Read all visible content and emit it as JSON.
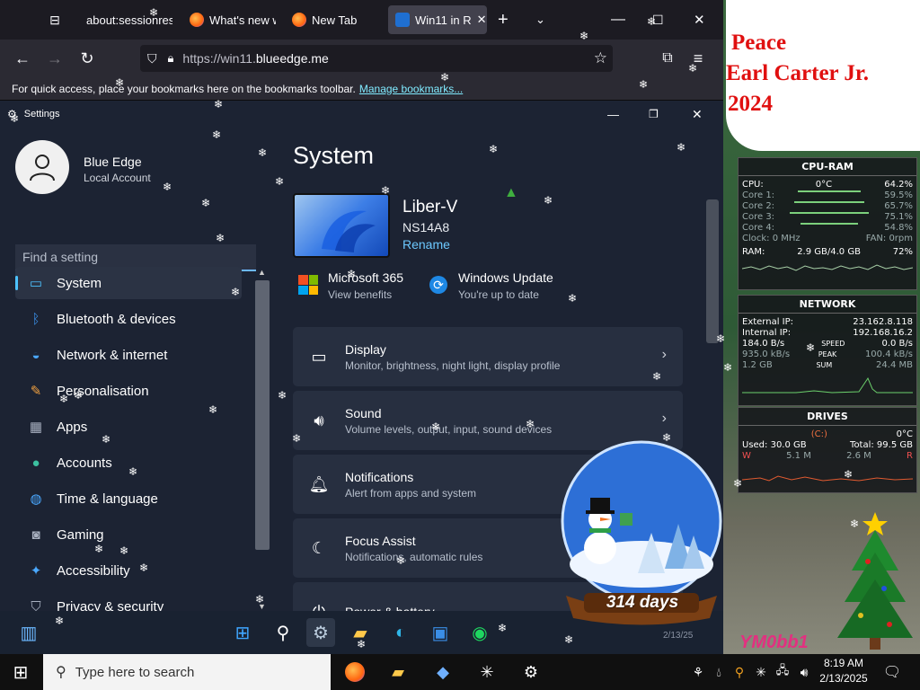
{
  "browser": {
    "tabs": [
      {
        "label": "about:sessionrest",
        "icon": "restore-icon"
      },
      {
        "label": "What's new w",
        "icon": "firefox-icon"
      },
      {
        "label": "New Tab",
        "icon": "firefox-icon"
      },
      {
        "label": "Win11 in R",
        "icon": "win11-favicon"
      }
    ],
    "url_prefix": "https://win11.",
    "url_domain": "blueedge.me",
    "bookmarks_text": "For quick access, place your bookmarks here on the bookmarks toolbar.",
    "bookmarks_link": "Manage bookmarks..."
  },
  "settings": {
    "window_title": "Settings",
    "user_name": "Blue Edge",
    "account_type": "Local Account",
    "search_placeholder": "Find a setting",
    "nav": [
      {
        "label": "System",
        "icon": "system-icon",
        "selected": true
      },
      {
        "label": "Bluetooth & devices",
        "icon": "bluetooth-icon"
      },
      {
        "label": "Network & internet",
        "icon": "wifi-icon"
      },
      {
        "label": "Personalisation",
        "icon": "brush-icon"
      },
      {
        "label": "Apps",
        "icon": "apps-icon"
      },
      {
        "label": "Accounts",
        "icon": "account-icon"
      },
      {
        "label": "Time & language",
        "icon": "globe-icon"
      },
      {
        "label": "Gaming",
        "icon": "gamepad-icon"
      },
      {
        "label": "Accessibility",
        "icon": "accessibility-icon"
      },
      {
        "label": "Privacy & security",
        "icon": "shield-icon"
      }
    ],
    "page_title": "System",
    "device_name": "Liber-V",
    "device_model": "NS14A8",
    "rename_label": "Rename",
    "ms365_title": "Microsoft 365",
    "ms365_sub": "View benefits",
    "wu_title": "Windows Update",
    "wu_sub": "You're up to date",
    "cards": [
      {
        "title": "Display",
        "sub": "Monitor, brightness, night light, display profile",
        "icon": "display-icon"
      },
      {
        "title": "Sound",
        "sub": "Volume levels, output, input, sound devices",
        "icon": "speaker-icon"
      },
      {
        "title": "Notifications",
        "sub": "Alert from apps and system",
        "icon": "bell-icon"
      },
      {
        "title": "Focus Assist",
        "sub": "Notifications, automatic rules",
        "icon": "moon-icon"
      },
      {
        "title": "Power & battery",
        "sub": "",
        "icon": "power-icon"
      }
    ],
    "win_tray_date": "2/13/25"
  },
  "greeting": {
    "line1": "Peace",
    "line2": "Earl Carter Jr.",
    "line3": "2024"
  },
  "cpu_gadget": {
    "title": "CPU-RAM",
    "cpu_label": "CPU:",
    "cpu_temp": "0°C",
    "cpu_pct": "64.2%",
    "cores": [
      {
        "label": "Core 1:",
        "value": "59.5%",
        "fill": 0.595
      },
      {
        "label": "Core 2:",
        "value": "65.7%",
        "fill": 0.657
      },
      {
        "label": "Core 3:",
        "value": "75.1%",
        "fill": 0.751
      },
      {
        "label": "Core 4:",
        "value": "54.8%",
        "fill": 0.548
      }
    ],
    "clock": "Clock: 0 MHz",
    "fan": "FAN: 0rpm",
    "ram_label": "RAM:",
    "ram_usage": "2.9 GB/4.0 GB",
    "ram_pct": "72%"
  },
  "net_gadget": {
    "title": "NETWORK",
    "ext_label": "External IP:",
    "ext_ip": "23.162.8.118",
    "int_label": "Internal IP:",
    "int_ip": "192.168.16.2",
    "speed_down": "184.0 B/s",
    "speed_label": "SPEED",
    "speed_up": "0.0 B/s",
    "peak_down": "935.0 kB/s",
    "peak_label": "PEAK",
    "peak_up": "100.4 kB/s",
    "sum_down": "1.2 GB",
    "sum_label": "SUM",
    "sum_up": "24.4 MB"
  },
  "drives_gadget": {
    "title": "DRIVES",
    "drive": "(C:)",
    "temp": "0°C",
    "used": "Used: 30.0 GB",
    "total": "Total: 99.5 GB",
    "read_label": "W",
    "read": "5.1 M",
    "write": "2.6 M",
    "write_label": "R"
  },
  "snowglobe": {
    "days": "314 days"
  },
  "watermark": "YM0bb1",
  "host_taskbar": {
    "search_placeholder": "Type here to search",
    "time": "8:19 AM",
    "date": "2/13/2025"
  }
}
